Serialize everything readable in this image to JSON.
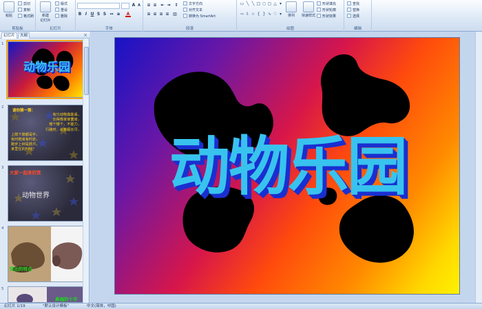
{
  "ribbon": {
    "clipboard": {
      "paste": "粘贴",
      "cut": "剪切",
      "copy": "复制",
      "format_painter": "格式刷",
      "label": "剪贴板"
    },
    "slides": {
      "new_slide": "新建\n幻灯片",
      "layout": "版式",
      "reset": "重设",
      "delete": "删除",
      "label": "幻灯片"
    },
    "font": {
      "label": "字体"
    },
    "paragraph": {
      "text_direction": "文字方向",
      "align_text": "对齐文本",
      "smartart": "转换为 SmartArt",
      "label": "段落"
    },
    "drawing": {
      "arrange": "排列",
      "quick_styles": "快速样式",
      "shape_fill": "形状填充",
      "shape_outline": "形状轮廓",
      "shape_effects": "形状效果",
      "label": "绘图"
    },
    "editing": {
      "find": "查找",
      "replace": "替换",
      "select": "选择",
      "label": "编辑"
    }
  },
  "panel": {
    "tabs": [
      "幻灯片",
      "大纲"
    ],
    "close": "×",
    "slides": [
      {
        "num": "1",
        "title": "动物乐园"
      },
      {
        "num": "2",
        "heading": "请你猜一猜：",
        "lines": [
          "有只动物真能丢，",
          "长得像家家菌房，",
          "矮个矮个，不能力，",
          "行路时，长着假长牙，",
          "上肢下肢都是手，",
          "有时爬来有时走，",
          "跑步上树是肢爪，",
          "家里住的叫啥？"
        ]
      },
      {
        "num": "3",
        "banner": "大家一起来欣赏",
        "title": "动物世界"
      },
      {
        "num": "4",
        "caption": "突出的特点"
      },
      {
        "num": "5",
        "caption": "鼻端的十字"
      }
    ]
  },
  "slide": {
    "title": "动物乐园"
  },
  "status": {
    "slide_count": "幻灯片 1/19",
    "theme": "\"默认设计模板\"",
    "language": "中文(简体，中国)"
  },
  "colors": {
    "title_fill": "#38c3ee",
    "title_shadow": "#1a2fd0",
    "silhouette": "#000000"
  }
}
